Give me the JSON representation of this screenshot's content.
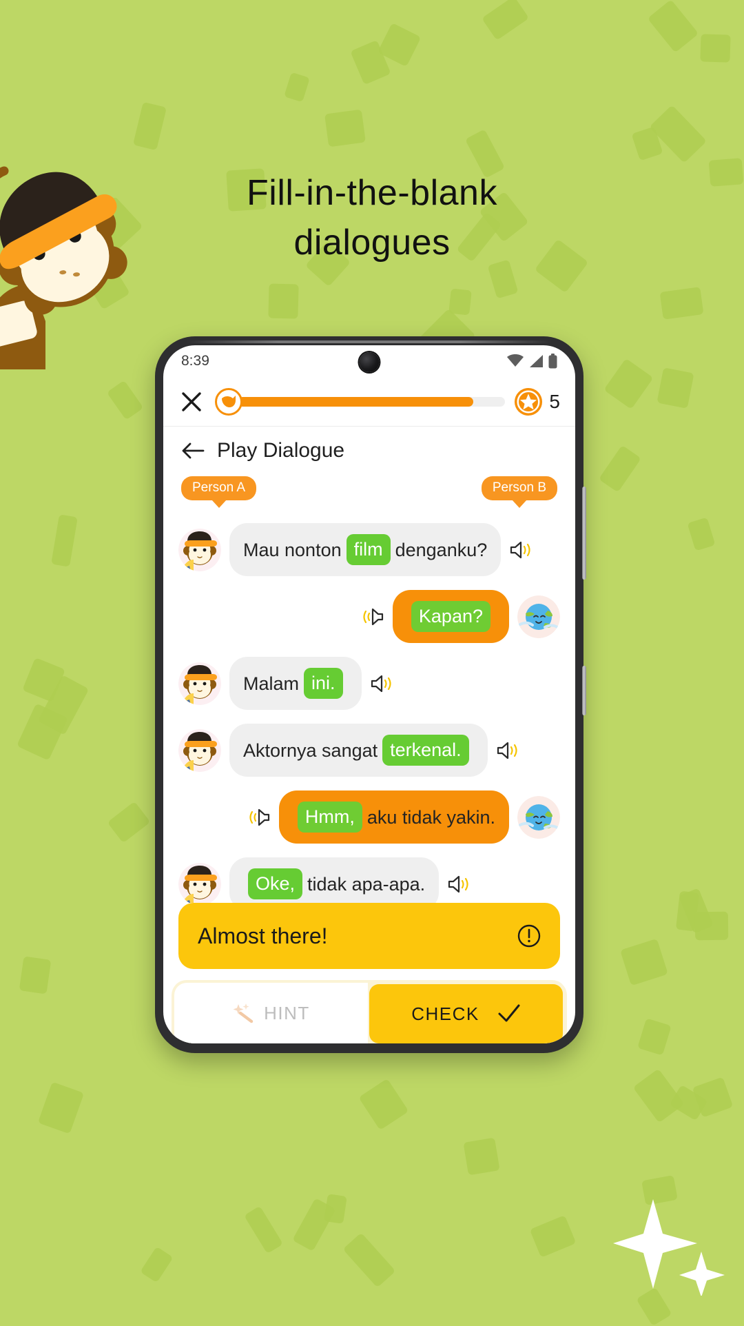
{
  "theme": {
    "background": "#bdd765",
    "confetti": "#afce51",
    "orange": "#F79009",
    "orange_tag": "#F89621",
    "green_blank": "#66CC33",
    "yellow": "#FCC60C",
    "bubble_gray": "#efefef"
  },
  "headline": {
    "line1": "Fill-in-the-blank",
    "line2": "dialogues"
  },
  "decor": {
    "mascot_name": "monkey-mascot",
    "sparkle_name": "sparkle-stars"
  },
  "statusbar": {
    "time": "8:39",
    "icons": [
      "wifi-icon",
      "cellular-signal-icon",
      "battery-icon"
    ]
  },
  "topbar": {
    "close_icon": "close-icon",
    "progress_badge_icon": "bird-badge-icon",
    "progress_percent": 88,
    "coin_icon": "star-coin-icon",
    "coin_count": "5"
  },
  "header": {
    "back_icon": "back-arrow-icon",
    "title": "Play Dialogue"
  },
  "persons": {
    "a": "Person A",
    "b": "Person B"
  },
  "chat": {
    "messages": [
      {
        "side": "left",
        "avatar": "monkey-avatar",
        "bubble": "gray",
        "speaker_icon": "speaker-icon",
        "parts": [
          {
            "type": "text",
            "value": "Mau nonton"
          },
          {
            "type": "blank",
            "value": "film"
          },
          {
            "type": "text",
            "value": "denganku?"
          }
        ]
      },
      {
        "side": "right",
        "avatar": "globe-avatar",
        "bubble": "orange",
        "speaker_icon": "speaker-icon-mirrored",
        "parts": [
          {
            "type": "blank",
            "value": "Kapan?"
          }
        ]
      },
      {
        "side": "left",
        "avatar": "monkey-avatar",
        "bubble": "gray",
        "speaker_icon": "speaker-icon",
        "parts": [
          {
            "type": "text",
            "value": "Malam"
          },
          {
            "type": "blank",
            "value": "ini."
          }
        ]
      },
      {
        "side": "left",
        "avatar": "monkey-avatar",
        "bubble": "gray",
        "speaker_icon": "speaker-icon",
        "parts": [
          {
            "type": "text",
            "value": "Aktornya sangat"
          },
          {
            "type": "blank",
            "value": "terkenal."
          }
        ]
      },
      {
        "side": "right",
        "avatar": "globe-avatar",
        "bubble": "orange",
        "speaker_icon": "speaker-icon-mirrored",
        "parts": [
          {
            "type": "blank",
            "value": "Hmm,"
          },
          {
            "type": "text",
            "value": "aku tidak yakin."
          }
        ]
      },
      {
        "side": "left",
        "avatar": "monkey-avatar",
        "bubble": "gray",
        "speaker_icon": "speaker-icon",
        "parts": [
          {
            "type": "blank",
            "value": "Oke,"
          },
          {
            "type": "text",
            "value": "tidak apa-apa."
          }
        ]
      }
    ]
  },
  "feedback": {
    "text": "Almost there!",
    "icon": "exclamation-circle-icon"
  },
  "actions": {
    "hint_label": "HINT",
    "hint_icon": "magic-sparkle-icon",
    "hint_enabled": false,
    "check_label": "CHECK",
    "check_icon": "checkmark-icon"
  }
}
